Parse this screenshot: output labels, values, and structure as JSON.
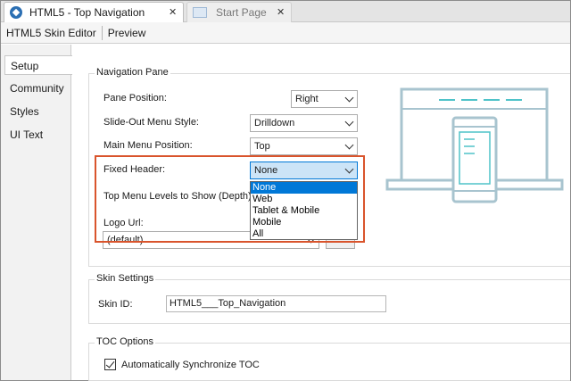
{
  "tabs": [
    {
      "label": "HTML5 - Top Navigation"
    },
    {
      "label": "Start Page"
    }
  ],
  "toolbar": {
    "editor_label": "HTML5 Skin Editor",
    "preview_label": "Preview"
  },
  "sidebar": {
    "items": [
      {
        "label": "Setup"
      },
      {
        "label": "Community"
      },
      {
        "label": "Styles"
      },
      {
        "label": "UI Text"
      }
    ]
  },
  "navigation_pane": {
    "title": "Navigation Pane",
    "pane_position_label": "Pane Position:",
    "pane_position_value": "Right",
    "slideout_label": "Slide-Out Menu Style:",
    "slideout_value": "Drilldown",
    "main_menu_label": "Main Menu Position:",
    "main_menu_value": "Top",
    "fixed_header_label": "Fixed Header:",
    "fixed_header_value": "None",
    "fixed_header_options": [
      "None",
      "Web",
      "Tablet & Mobile",
      "Mobile",
      "All"
    ],
    "top_menu_levels_label": "Top Menu Levels to Show (Depth):",
    "logo_url_label": "Logo Url:",
    "logo_url_value": "(default)"
  },
  "skin_settings": {
    "title": "Skin Settings",
    "skin_id_label": "Skin ID:",
    "skin_id_value": "HTML5___Top_Navigation"
  },
  "toc_options": {
    "title": "TOC Options",
    "sync_label": "Automatically Synchronize TOC",
    "sync_checked": true
  },
  "colors": {
    "accent": "#0078d7",
    "highlight_box": "#d9542c",
    "illustration": "#a8c4cf",
    "illustration_accent": "#4fc3c9"
  }
}
